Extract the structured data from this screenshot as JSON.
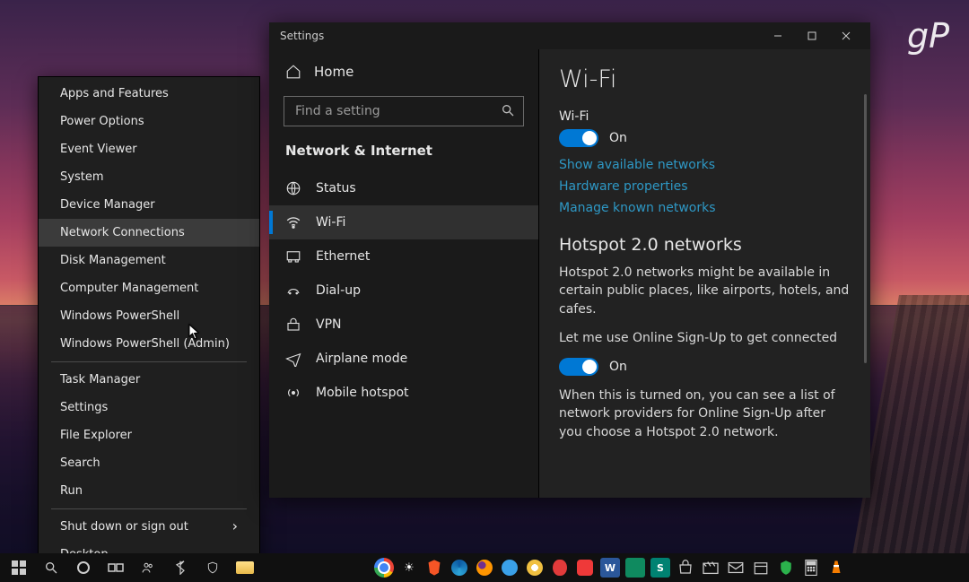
{
  "watermark": "gP",
  "winx": {
    "group1": [
      "Apps and Features",
      "Power Options",
      "Event Viewer",
      "System",
      "Device Manager",
      "Network Connections",
      "Disk Management",
      "Computer Management",
      "Windows PowerShell",
      "Windows PowerShell (Admin)"
    ],
    "group2": [
      "Task Manager",
      "Settings",
      "File Explorer",
      "Search",
      "Run"
    ],
    "group3": [
      "Shut down or sign out",
      "Desktop"
    ],
    "hovered_index": 5,
    "flyout_index": 0
  },
  "settings": {
    "title": "Settings",
    "window_controls": {
      "min": "—",
      "max": "▢",
      "close": "✕"
    },
    "home": "Home",
    "search_placeholder": "Find a setting",
    "category": "Network & Internet",
    "nav": [
      {
        "icon": "status-icon",
        "label": "Status"
      },
      {
        "icon": "wifi-icon",
        "label": "Wi-Fi",
        "active": true
      },
      {
        "icon": "ethernet-icon",
        "label": "Ethernet"
      },
      {
        "icon": "dialup-icon",
        "label": "Dial-up"
      },
      {
        "icon": "vpn-icon",
        "label": "VPN"
      },
      {
        "icon": "airplane-icon",
        "label": "Airplane mode"
      },
      {
        "icon": "hotspot-icon",
        "label": "Mobile hotspot"
      }
    ],
    "page": {
      "title": "Wi-Fi",
      "wifi_label": "Wi-Fi",
      "wifi_state": "On",
      "links": [
        "Show available networks",
        "Hardware properties",
        "Manage known networks"
      ],
      "hotspot_heading": "Hotspot 2.0 networks",
      "hotspot_desc": "Hotspot 2.0 networks might be available in certain public places, like airports, hotels, and cafes.",
      "signup_label": "Let me use Online Sign-Up to get connected",
      "signup_state": "On",
      "signup_desc": "When this is turned on, you can see a list of network providers for Online Sign-Up after you choose a Hotspot 2.0 network."
    }
  },
  "taskbar": {
    "left": [
      "start",
      "search",
      "cortana",
      "taskview",
      "people",
      "bluetooth",
      "defender",
      "explorer"
    ],
    "center": [
      "chrome",
      "sun",
      "brave",
      "edge",
      "firefox",
      "ie",
      "duck",
      "opera",
      "vivaldi",
      "word",
      "filmstrip",
      "sway",
      "store",
      "clapper",
      "mail",
      "calendar",
      "shield",
      "calc",
      "vlc"
    ],
    "right": {}
  }
}
